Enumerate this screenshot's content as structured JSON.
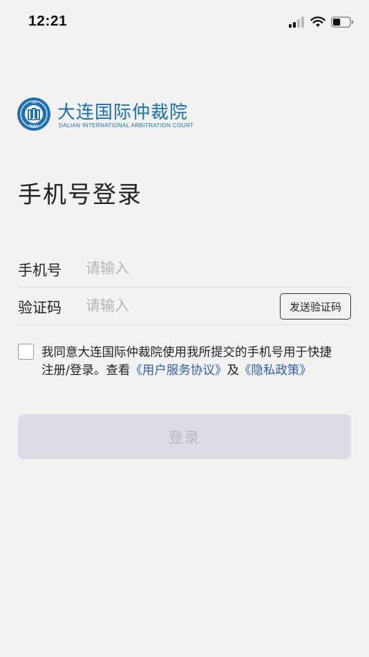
{
  "status_bar": {
    "time": "12:21",
    "icons": [
      "signal-icon",
      "wifi-icon",
      "battery-icon"
    ],
    "battery_level": 0.45
  },
  "logo": {
    "name_cn": "大连国际仲裁院",
    "name_en": "DALIAN  INTERNATIONAL ARBITRATION COURT",
    "emblem_letters": "DIAC",
    "emblem_year": "1986"
  },
  "title": "手机号登录",
  "form": {
    "phone": {
      "label": "手机号",
      "placeholder": "请输入"
    },
    "code": {
      "label": "验证码",
      "placeholder": "请输入",
      "send_button": "发送验证码"
    }
  },
  "agreement": {
    "text_before": "我同意大连国际仲裁院使用我所提交的手机号用于快捷注册/登录。查看",
    "link_terms": "《用户服务协议》",
    "and": "及",
    "link_privacy": "《隐私政策》"
  },
  "login_button": "登录",
  "colors": {
    "brand": "#1a6fb0",
    "link": "#2d5db5",
    "background": "#f2f2f2",
    "button_disabled": "#dcdce4"
  }
}
